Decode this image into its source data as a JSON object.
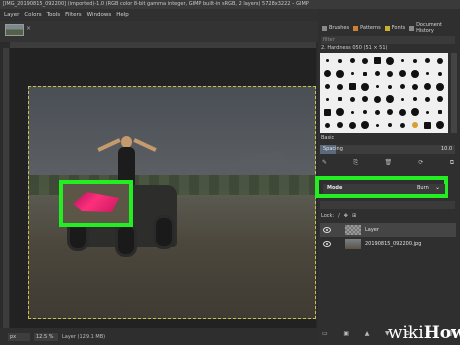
{
  "window": {
    "title": "[IMG_20190815_092200] (imported)-1.0 (RGB color 8-bit gamma integer, GIMP built-in sRGB, 2 layers) 5728x3222 – GIMP"
  },
  "menu": [
    "Layer",
    "Colors",
    "Tools",
    "Filters",
    "Windows",
    "Help"
  ],
  "image_tab": {
    "close": "×"
  },
  "dock": {
    "tabs": [
      "Brushes",
      "Patterns",
      "Fonts",
      "Document History"
    ],
    "filter_placeholder": "filter",
    "brush_name": "2. Hardness 050 (51 × 51)",
    "section": "Basic",
    "spacing_label": "Spacing",
    "spacing_value": "10.0",
    "spacing_fraction": 0.12,
    "brush_actions": [
      "✎",
      "⎘",
      "🗑",
      "⟳",
      "⧉"
    ]
  },
  "layers": {
    "mode_label": "Mode",
    "mode_value": "Burn",
    "mode_chevron": "⌄",
    "lock_label": "Lock:",
    "lock_icons": [
      "/",
      "✥",
      "⊞"
    ],
    "items": [
      {
        "name": "Layer"
      },
      {
        "name": "20190815_092200.jpg"
      }
    ],
    "actions": [
      "▭",
      "▣",
      "▲",
      "▼",
      "⧉",
      "⚓",
      "🗑"
    ]
  },
  "statusbar": {
    "unit": "px",
    "zoom": "12.5 %",
    "text": "Layer (129.1 MB)"
  },
  "highlight_color": "#22ee22",
  "watermark": {
    "prefix": "wiki",
    "suffix": "How"
  }
}
